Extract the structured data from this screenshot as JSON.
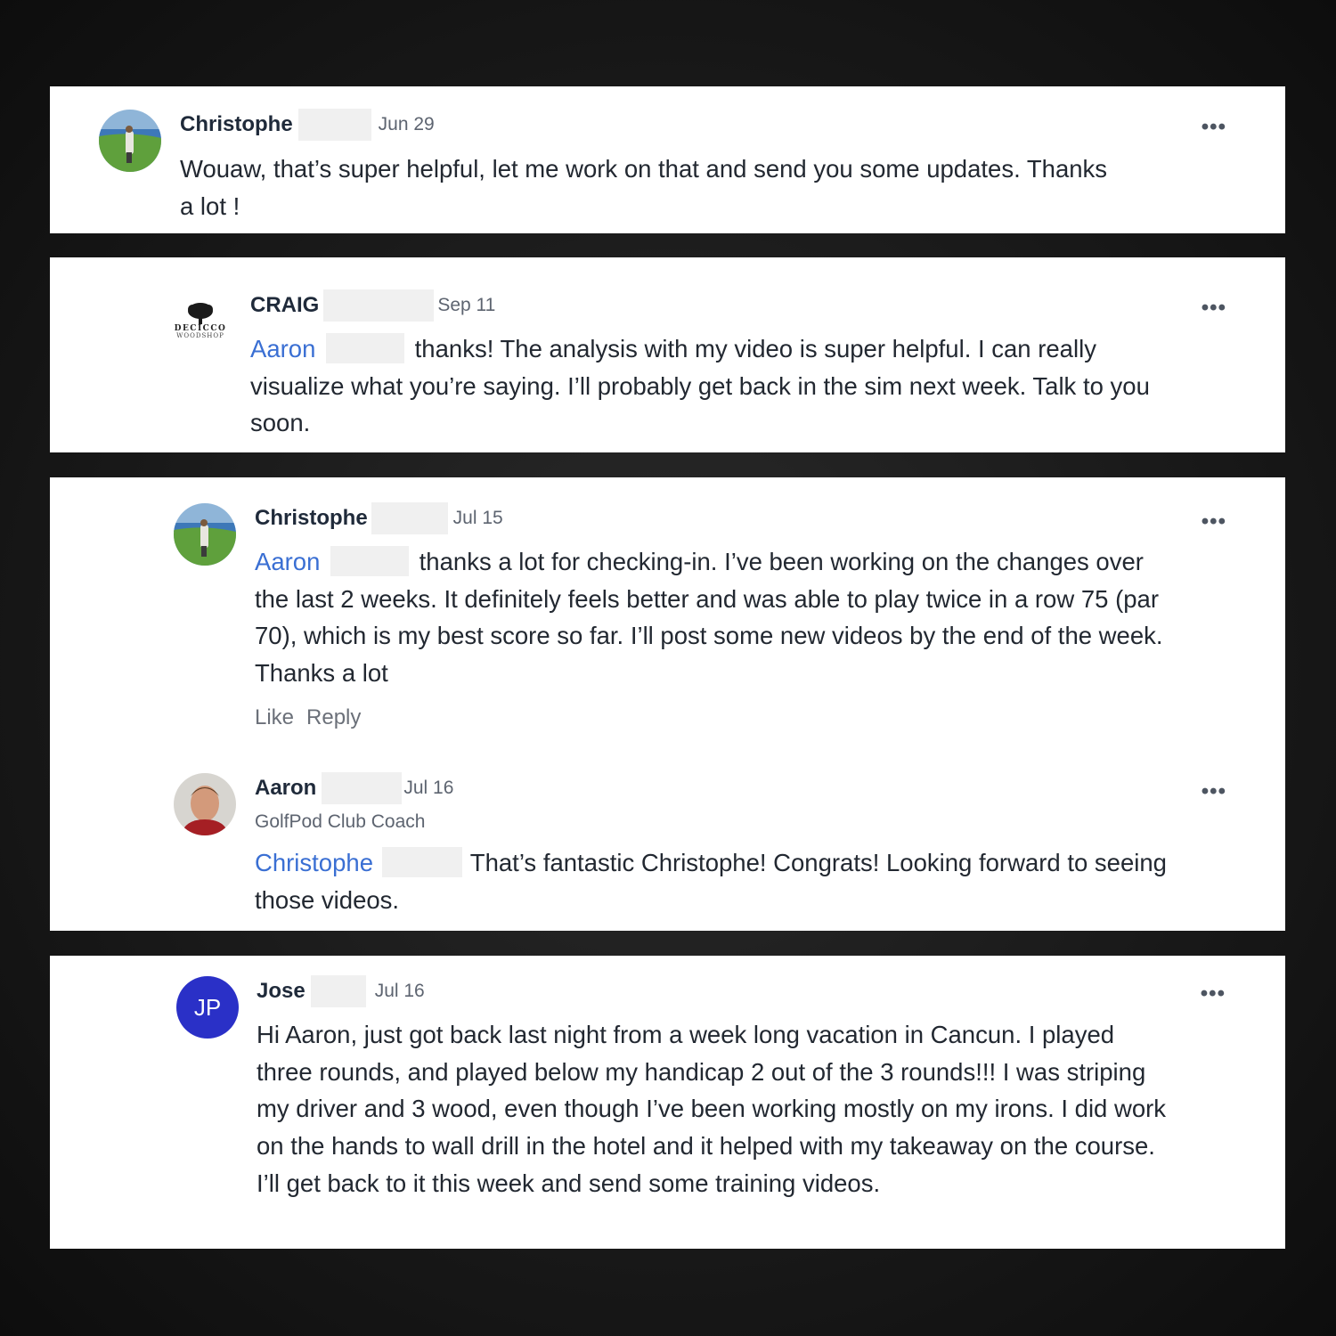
{
  "comments": [
    {
      "author": "Christophe",
      "date": "Jun 29",
      "body": "Wouaw, that’s super helpful, let me work on that and send you some updates. Thanks a lot !"
    },
    {
      "author": "CRAIG",
      "date": "Sep 11",
      "logo": {
        "line1": "DECICCO",
        "line2": "WOODSHOP",
        "icon": "tree-logo-icon"
      },
      "mention": "Aaron",
      "body": "thanks! The analysis with my video is super helpful. I can really visualize what you’re saying.  I’ll probably get back in the sim next week. Talk to you soon."
    },
    {
      "author": "Christophe",
      "date": "Jul 15",
      "mention": "Aaron",
      "body": "thanks a lot for checking-in. I’ve been working on the changes over the last 2 weeks. It definitely feels better and was able to play twice in a row 75 (par 70), which is my best score so far. I’ll post some new videos by the end of the week. Thanks a lot",
      "actions": {
        "like": "Like",
        "reply": "Reply"
      }
    },
    {
      "author": "Aaron",
      "date": "Jul 16",
      "role": "GolfPod Club Coach",
      "mention": "Christophe",
      "body": "That’s fantastic Christophe!  Congrats!  Looking forward to seeing those videos."
    },
    {
      "author": "Jose",
      "date": "Jul 16",
      "initials": "JP",
      "avatar_color": "#2a30c7",
      "body": "Hi Aaron, just got back last night from a week long vacation in Cancun. I played three rounds, and played below my handicap 2 out of the 3 rounds!!! I was striping my driver and 3 wood, even though I’ve been working mostly on my irons. I did work on the hands to wall drill in the hotel and it helped with my takeaway on the course. I’ll get back to it this week and send some training videos."
    }
  ],
  "more_menu": "•••",
  "colors": {
    "mention": "#3a6fd3",
    "name": "#1f2a3a",
    "meta": "#5d6470"
  }
}
